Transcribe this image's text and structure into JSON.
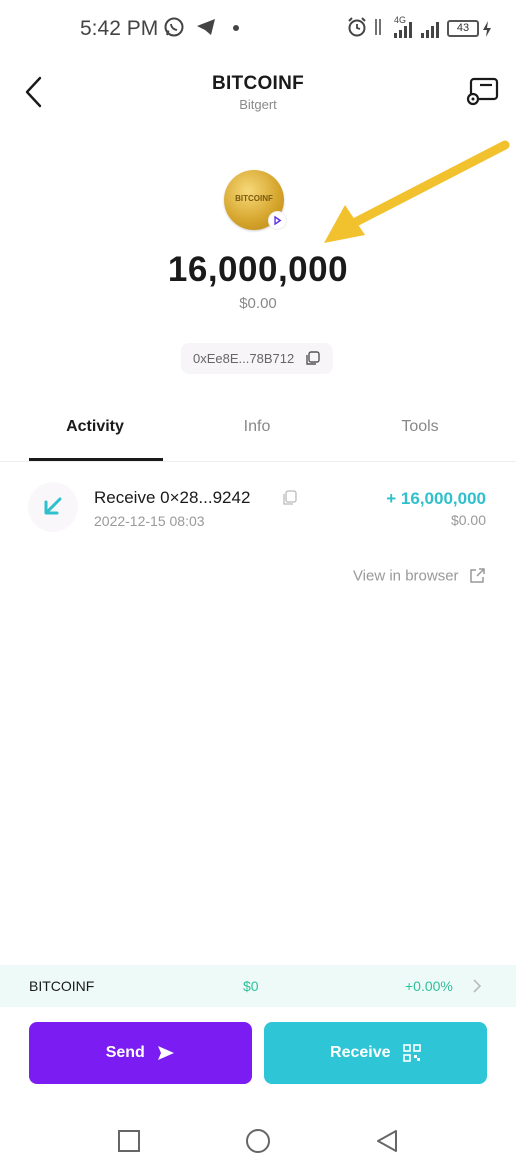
{
  "status_bar": {
    "time": "5:42 PM",
    "network": "4G",
    "battery": "43",
    "icons": [
      "whatsapp-icon",
      "telegram-icon",
      "dot-icon",
      "alarm-icon",
      "data-arrows-icon",
      "signal-icon",
      "signal-icon",
      "battery-icon",
      "charging-icon"
    ]
  },
  "header": {
    "title": "BITCOINF",
    "subtitle": "Bitgert"
  },
  "token": {
    "logo_text": "BITCOINF",
    "balance": "16,000,000",
    "fiat_value": "$0.00",
    "address": "0xEe8E...78B712",
    "accent_color": "#f2c12e"
  },
  "tabs": [
    {
      "label": "Activity",
      "active": true
    },
    {
      "label": "Info",
      "active": false
    },
    {
      "label": "Tools",
      "active": false
    }
  ],
  "transactions": [
    {
      "title": "Receive  0×28...9242",
      "date": "2022-12-15 08:03",
      "amount": "+ 16,000,000",
      "fiat": "$0.00"
    }
  ],
  "view_in_browser": "View in browser",
  "price_bar": {
    "name": "BITCOINF",
    "price": "$0",
    "change": "+0.00%"
  },
  "actions": {
    "send_label": "Send",
    "receive_label": "Receive"
  },
  "colors": {
    "send": "#7a1cf2",
    "receive": "#2ec6d6",
    "positive": "#2fbf9a"
  }
}
